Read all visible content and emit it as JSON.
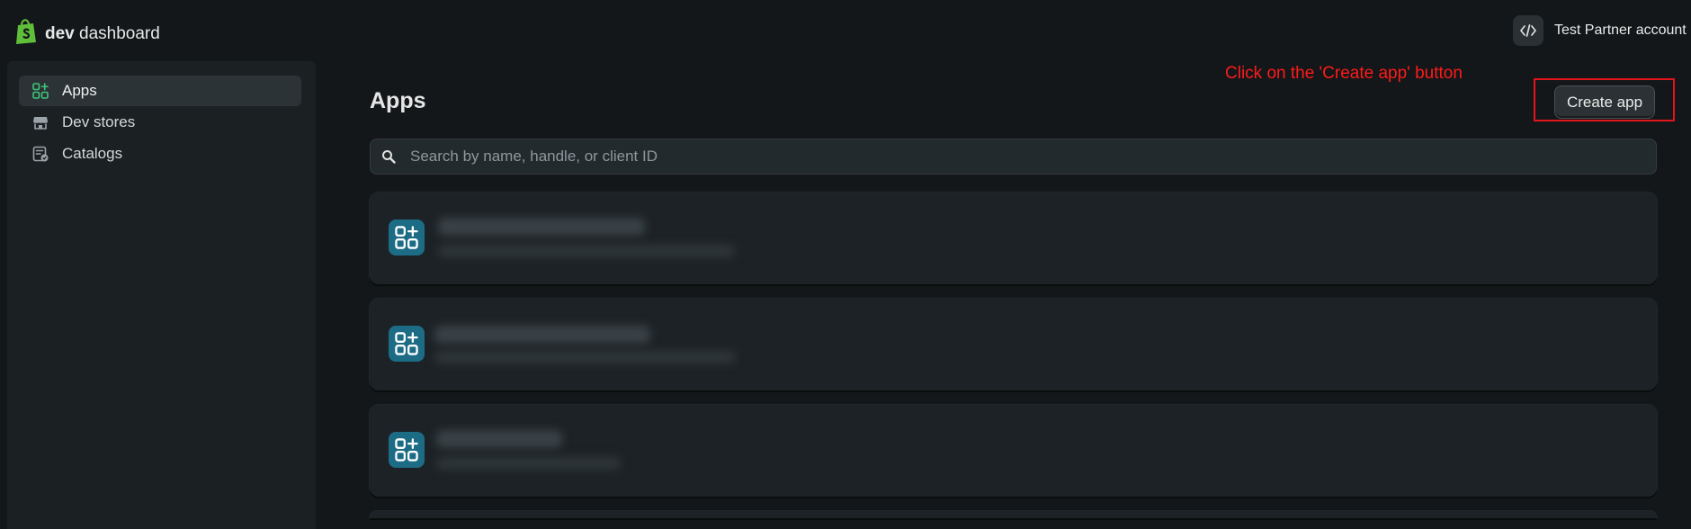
{
  "brand": {
    "bold": "dev",
    "rest": "dashboard"
  },
  "account": {
    "name": "Test Partner account"
  },
  "sidebar": {
    "items": [
      {
        "label": "Apps",
        "icon": "apps-icon",
        "active": true
      },
      {
        "label": "Dev stores",
        "icon": "store-icon",
        "active": false
      },
      {
        "label": "Catalogs",
        "icon": "catalog-icon",
        "active": false
      }
    ]
  },
  "main": {
    "title": "Apps",
    "create_button": "Create app",
    "search_placeholder": "Search by name, handle, or client ID",
    "apps_count_visible": 3
  },
  "annotation": {
    "text": "Click on the 'Create app' button",
    "color": "#ff1a1a"
  },
  "colors": {
    "background": "#131719",
    "sidebar": "#1b2023",
    "accent_green": "#3ec47a",
    "app_icon_bg": "#1d6c86"
  }
}
